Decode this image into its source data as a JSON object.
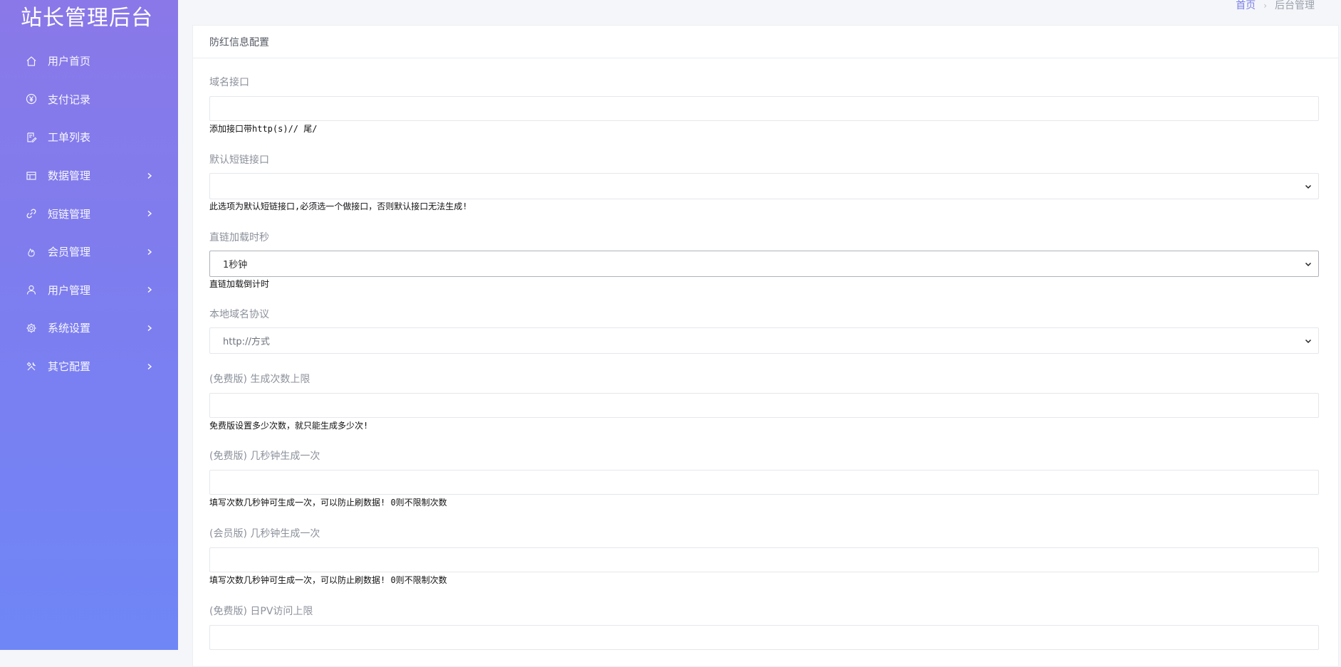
{
  "app": {
    "title": "站长管理后台"
  },
  "sidebar": {
    "items": [
      {
        "label": "用户首页",
        "icon": "home-icon",
        "has_children": false
      },
      {
        "label": "支付记录",
        "icon": "yen-icon",
        "has_children": false
      },
      {
        "label": "工单列表",
        "icon": "ticket-edit-icon",
        "has_children": false
      },
      {
        "label": "数据管理",
        "icon": "table-icon",
        "has_children": true
      },
      {
        "label": "短链管理",
        "icon": "link-icon",
        "has_children": true
      },
      {
        "label": "会员管理",
        "icon": "fire-icon",
        "has_children": true
      },
      {
        "label": "用户管理",
        "icon": "user-icon",
        "has_children": true
      },
      {
        "label": "系统设置",
        "icon": "gear-icon",
        "has_children": true
      },
      {
        "label": "其它配置",
        "icon": "tools-icon",
        "has_children": true
      }
    ]
  },
  "breadcrumb": {
    "home": "首页",
    "separator": "›",
    "current": "后台管理"
  },
  "card": {
    "title": "防红信息配置"
  },
  "form": {
    "fields": [
      {
        "label": "域名接口",
        "type": "input",
        "value": "",
        "help": "添加接口带http(s)// 尾/"
      },
      {
        "label": "默认短链接口",
        "type": "select",
        "value": "",
        "help": "此选项为默认短链接口,必须选一个做接口，否则默认接口无法生成!"
      },
      {
        "label": "直链加载时秒",
        "type": "select",
        "value": "1秒钟",
        "help": "直链加载倒计时"
      },
      {
        "label": "本地域名协议",
        "type": "select",
        "value": "http://方式",
        "help": ""
      },
      {
        "label": "(免费版) 生成次数上限",
        "type": "input",
        "value": "",
        "help": "免费版设置多少次数，就只能生成多少次!"
      },
      {
        "label": "(免费版) 几秒钟生成一次",
        "type": "input",
        "value": "",
        "help": "填写次数几秒钟可生成一次，可以防止刷数据! 0则不限制次数"
      },
      {
        "label": "(会员版) 几秒钟生成一次",
        "type": "input",
        "value": "",
        "help": "填写次数几秒钟可生成一次，可以防止刷数据! 0则不限制次数"
      },
      {
        "label": "(免费版) 日PV访问上限",
        "type": "input",
        "value": "",
        "help": ""
      }
    ]
  },
  "colors": {
    "sidebar_top": "#8a78e8",
    "sidebar_bottom": "#6f86f6",
    "accent": "#7b7fe6"
  }
}
